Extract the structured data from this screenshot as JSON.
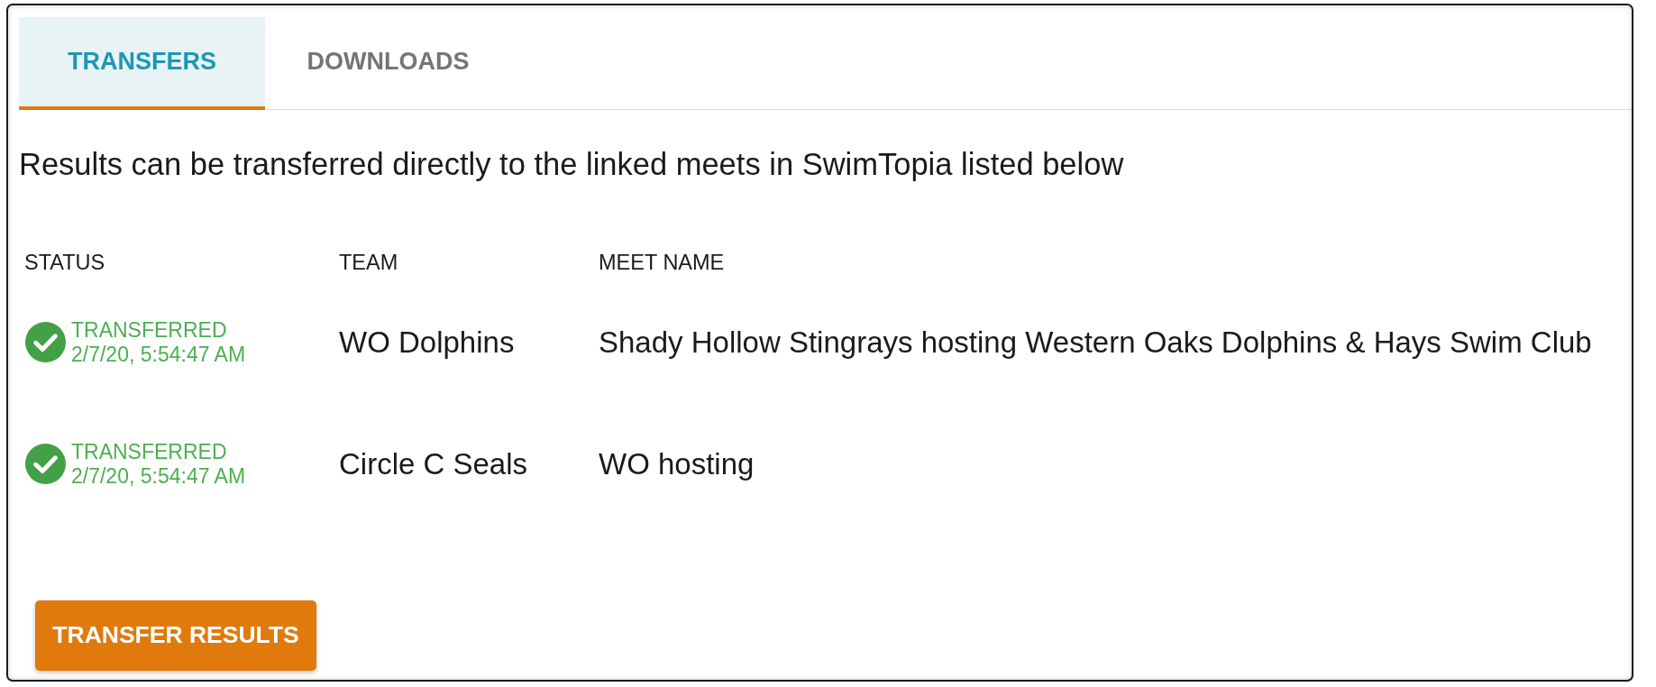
{
  "tabs": [
    {
      "label": "TRANSFERS",
      "selected": true
    },
    {
      "label": "DOWNLOADS",
      "selected": false
    }
  ],
  "description": "Results can be transferred directly to the linked meets in SwimTopia listed below",
  "table": {
    "columns": [
      "STATUS",
      "TEAM",
      "MEET NAME"
    ],
    "rows": [
      {
        "status": "TRANSFERRED",
        "time": "2/7/20, 5:54:47 AM",
        "team": "WO Dolphins",
        "meet_name": "Shady Hollow Stingrays hosting Western Oaks Dolphins & Hays Swim Club"
      },
      {
        "status": "TRANSFERRED",
        "time": "2/7/20, 5:54:47 AM",
        "team": "Circle C Seals",
        "meet_name": "WO hosting"
      }
    ]
  },
  "button": "TRANSFER RESULTS"
}
